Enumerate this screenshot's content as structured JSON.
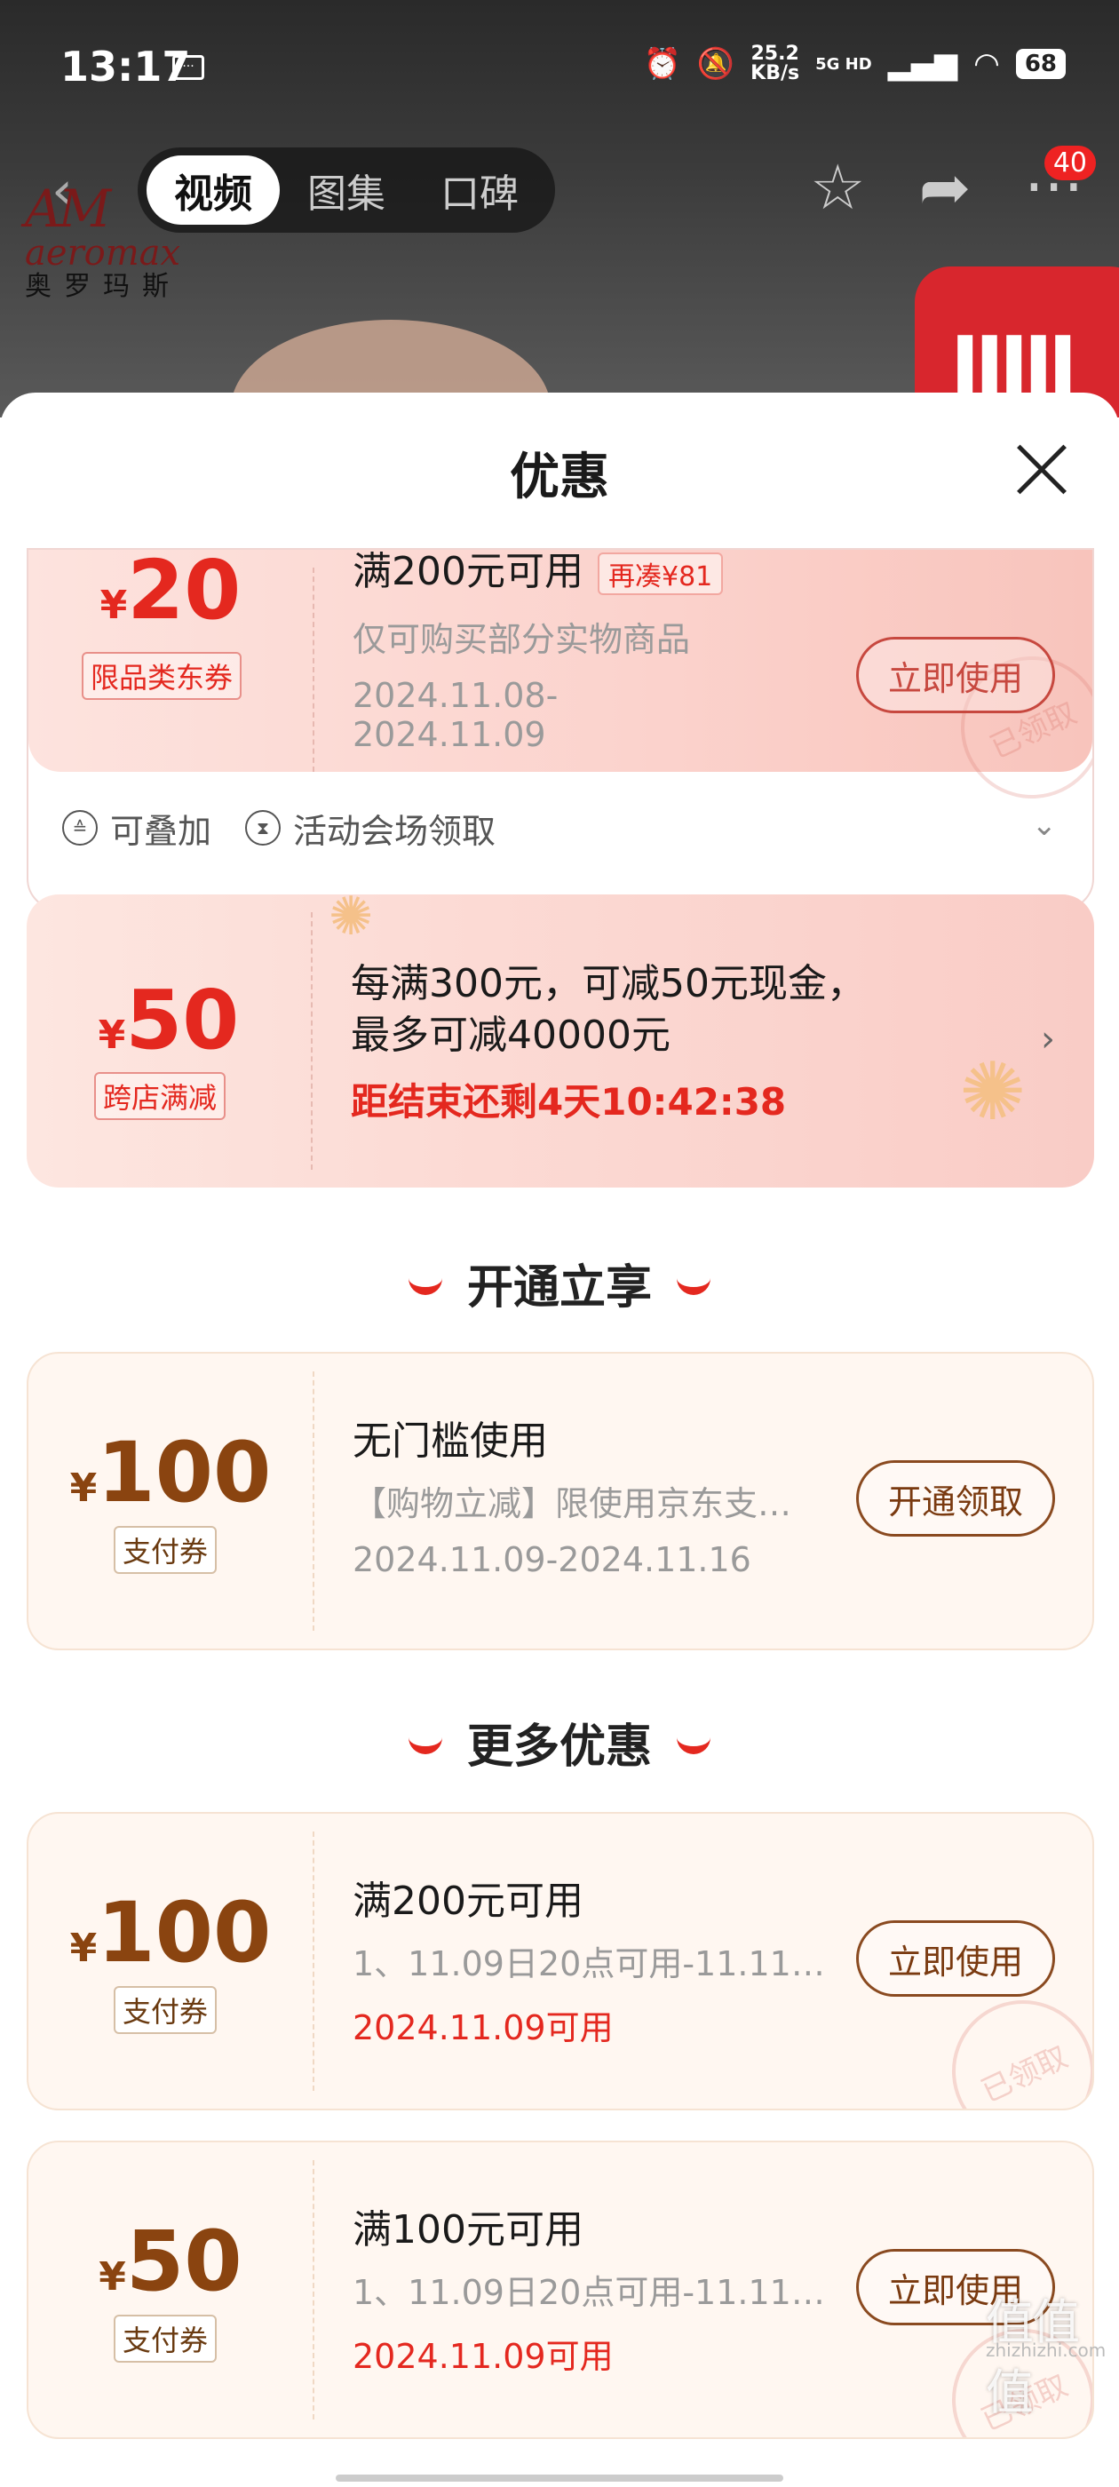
{
  "status_bar": {
    "time": "13:17",
    "speed_value": "25.2",
    "speed_unit": "KB/s",
    "network": "5G HD",
    "battery": "68"
  },
  "nav": {
    "tabs": [
      "视频",
      "图集",
      "口碑"
    ],
    "active_tab": 0,
    "badge": "40"
  },
  "brand_logo": {
    "mark": "AM",
    "name_en": "aeromax",
    "name_cn": "奥罗玛斯"
  },
  "sheet": {
    "title": "优惠"
  },
  "coupons_top": [
    {
      "yen": "¥",
      "amount": "20",
      "tag": "限品类东券",
      "condition": "满200元可用",
      "extra": "再凑¥81",
      "desc": "仅可购买部分实物商品",
      "date": "2024.11.08-2024.11.09",
      "button": "立即使用",
      "stamp": "已领取",
      "footer": [
        "可叠加",
        "活动会场领取"
      ]
    },
    {
      "yen": "¥",
      "amount": "50",
      "tag": "跨店满减",
      "line1": "每满300元，可减50元现金，",
      "line2": "最多可减40000元",
      "countdown": "距结束还剩4天10:42:38"
    }
  ],
  "section_open": {
    "title": "开通立享"
  },
  "coupon_open": {
    "yen": "¥",
    "amount": "100",
    "tag": "支付券",
    "condition": "无门槛使用",
    "desc": "【购物立减】限使用京东支…",
    "date": "2024.11.09-2024.11.16",
    "button": "开通领取"
  },
  "section_more": {
    "title": "更多优惠"
  },
  "coupons_more": [
    {
      "yen": "¥",
      "amount": "100",
      "tag": "支付券",
      "condition": "满200元可用",
      "desc": "1、11.09日20点可用-11.11…",
      "date": "2024.11.09可用",
      "button": "立即使用",
      "stamp": "已领取"
    },
    {
      "yen": "¥",
      "amount": "50",
      "tag": "支付券",
      "condition": "满100元可用",
      "desc": "1、11.09日20点可用-11.11…",
      "date": "2024.11.09可用",
      "button": "立即使用",
      "stamp": "已领取"
    }
  ],
  "watermark": {
    "main": "值值值",
    "sub": "zhizhizhi.com"
  }
}
